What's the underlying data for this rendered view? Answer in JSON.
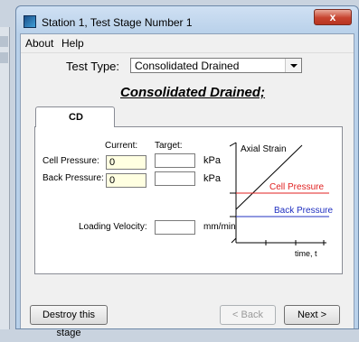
{
  "window": {
    "title": "Station 1, Test Stage Number 1",
    "close_label": "x"
  },
  "menu": {
    "items": [
      "About",
      "Help"
    ]
  },
  "test_type": {
    "label": "Test Type:",
    "selected": "Consolidated Drained"
  },
  "heading": "Consolidated Drained;",
  "tabs": [
    {
      "label": "CD"
    }
  ],
  "form": {
    "current_header": "Current:",
    "target_header": "Target:",
    "cell_pressure": {
      "label": "Cell Pressure:",
      "current": "0",
      "target": "",
      "unit": "kPa"
    },
    "back_pressure": {
      "label": "Back Pressure:",
      "current": "0",
      "target": "",
      "unit": "kPa"
    },
    "loading_velocity": {
      "label": "Loading Velocity:",
      "target": "",
      "unit": "mm/min"
    }
  },
  "diagram": {
    "axial_strain": "Axial Strain",
    "cell_pressure": "Cell Pressure",
    "back_pressure": "Back Pressure",
    "time_axis": "time, t",
    "colors": {
      "cell": "#e02020",
      "back": "#2030c0",
      "strain": "#000000"
    }
  },
  "buttons": {
    "destroy": "Destroy this stage",
    "back": "< Back",
    "next": "Next >"
  }
}
